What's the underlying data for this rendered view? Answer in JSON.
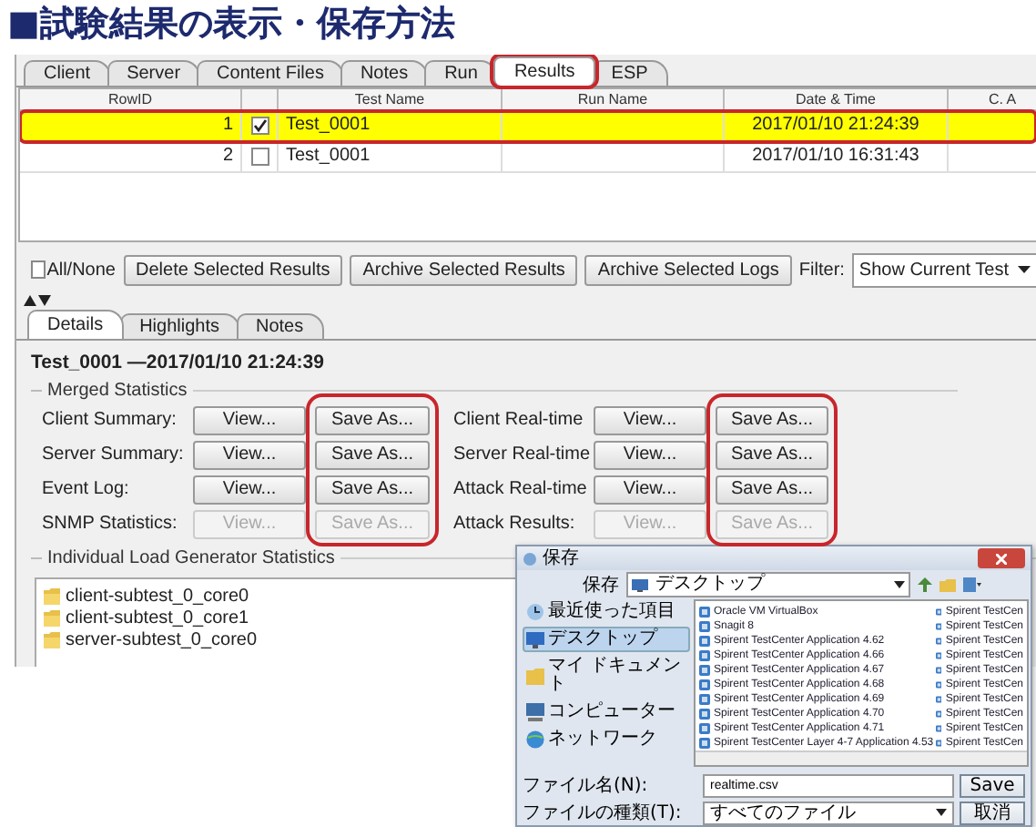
{
  "heading": "■試験結果の表示・保存方法",
  "tabs": [
    {
      "label": "Client",
      "selected": false,
      "highlighted": false
    },
    {
      "label": "Server",
      "selected": false,
      "highlighted": false
    },
    {
      "label": "Content Files",
      "selected": false,
      "highlighted": false
    },
    {
      "label": "Notes",
      "selected": false,
      "highlighted": false
    },
    {
      "label": "Run",
      "selected": false,
      "highlighted": false
    },
    {
      "label": "Results",
      "selected": true,
      "highlighted": true
    },
    {
      "label": "ESP",
      "selected": false,
      "highlighted": false
    }
  ],
  "table": {
    "columns": [
      "RowID",
      "Test Name",
      "Run Name",
      "Date & Time",
      "C. A"
    ],
    "rows": [
      {
        "row_id": "1",
        "checked": true,
        "test_name": "Test_0001",
        "date_time": "2017/01/10 21:24:39",
        "selected": true,
        "highlighted": true
      },
      {
        "row_id": "2",
        "checked": false,
        "test_name": "Test_0001",
        "date_time": "2017/01/10 16:31:43",
        "selected": false,
        "highlighted": false
      }
    ]
  },
  "toolbar": {
    "all_none": {
      "label": "All/None",
      "checked": false
    },
    "buttons": [
      "Delete Selected Results",
      "Archive Selected Results",
      "Archive Selected Logs"
    ],
    "filter_label": "Filter:",
    "filter_value": "Show Current Test"
  },
  "detail_tabs": [
    {
      "label": "Details",
      "selected": true
    },
    {
      "label": "Highlights",
      "selected": false
    },
    {
      "label": "Notes",
      "selected": false
    }
  ],
  "details": {
    "title": "Test_0001 —2017/01/10 21:24:39",
    "merged_label": "Merged Statistics",
    "save_highlighted": true,
    "stats": [
      {
        "label": "Client Summary:",
        "view": "View...",
        "save": "Save As...",
        "disabled": false
      },
      {
        "label": "Client Real-time",
        "view": "View...",
        "save": "Save As...",
        "disabled": false
      },
      {
        "label": "Server Summary:",
        "view": "View...",
        "save": "Save As...",
        "disabled": false
      },
      {
        "label": "Server Real-time",
        "view": "View...",
        "save": "Save As...",
        "disabled": false
      },
      {
        "label": "Event Log:",
        "view": "View...",
        "save": "Save As...",
        "disabled": false
      },
      {
        "label": "Attack Real-time",
        "view": "View...",
        "save": "Save As...",
        "disabled": false
      },
      {
        "label": "SNMP Statistics:",
        "view": "View...",
        "save": "Save As...",
        "disabled": true
      },
      {
        "label": "Attack Results:",
        "view": "View...",
        "save": "Save As...",
        "disabled": true
      }
    ],
    "individual_label": "Individual Load Generator Statistics",
    "tree": [
      {
        "label": "client-subtest_0_core0"
      },
      {
        "label": "client-subtest_0_core1"
      },
      {
        "label": "server-subtest_0_core0"
      }
    ]
  },
  "dialog": {
    "title": "保存",
    "save_in_label": "保存",
    "save_in_value": "デスクトップ",
    "places": [
      {
        "label": "最近使った項目",
        "selected": false
      },
      {
        "label": "デスクトップ",
        "selected": true
      },
      {
        "label": "マイ ドキュメント",
        "selected": false
      },
      {
        "label": "コンピューター",
        "selected": false
      },
      {
        "label": "ネットワーク",
        "selected": false
      }
    ],
    "files_column_1": [
      "Oracle VM VirtualBox",
      "Snagit 8",
      "Spirent TestCenter Application 4.62",
      "Spirent TestCenter Application 4.66",
      "Spirent TestCenter Application 4.67",
      "Spirent TestCenter Application 4.68",
      "Spirent TestCenter Application 4.69",
      "Spirent TestCenter Application 4.70",
      "Spirent TestCenter Application 4.71",
      "Spirent TestCenter Layer 4-7 Application 4.53"
    ],
    "files_column_2": [
      "Spirent TestCen",
      "Spirent TestCen",
      "Spirent TestCen",
      "Spirent TestCen",
      "Spirent TestCen",
      "Spirent TestCen",
      "Spirent TestCen",
      "Spirent TestCen",
      "Spirent TestCen",
      "Spirent TestCen"
    ],
    "file_name_label": "ファイル名(N):",
    "file_name_value": "realtime.csv",
    "file_type_label": "ファイルの種類(T):",
    "file_type_value": "すべてのファイル",
    "save_button": "Save",
    "cancel_button": "取消"
  }
}
